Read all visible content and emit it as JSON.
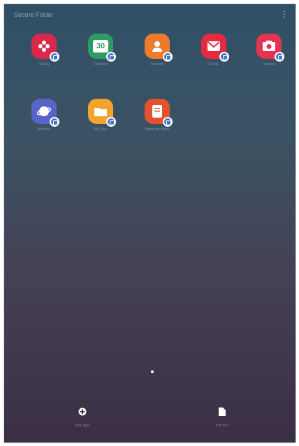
{
  "folder": {
    "title": "Secure Folder"
  },
  "apps": [
    {
      "name": "Gallery",
      "color": "#d8284b",
      "icon": "gallery-icon"
    },
    {
      "name": "Calendar",
      "color": "#2f9a63",
      "icon": "calendar-icon",
      "glyph": "30"
    },
    {
      "name": "Contacts",
      "color": "#ee7a2c",
      "icon": "contacts-icon"
    },
    {
      "name": "Email",
      "color": "#e52a42",
      "icon": "email-icon"
    },
    {
      "name": "Camera",
      "color": "#e3354f",
      "icon": "camera-icon"
    },
    {
      "name": "Internet",
      "color": "#5864c8",
      "icon": "internet-icon"
    },
    {
      "name": "My Files",
      "color": "#f2a42c",
      "icon": "my-files-icon"
    },
    {
      "name": "Samsung Notes",
      "color": "#e3522f",
      "icon": "samsung-notes-icon"
    }
  ],
  "bottom": {
    "add_label": "Add apps",
    "add_icon": "add-icon",
    "files_label": "Add files",
    "files_icon": "file-icon"
  }
}
